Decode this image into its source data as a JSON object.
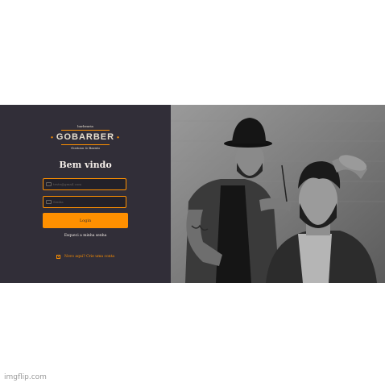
{
  "brand": {
    "top_text": "barbearia",
    "name": "GOBARBER",
    "tagline": "Gostoso & Barato"
  },
  "login": {
    "title": "Bem vindo",
    "email_placeholder": "teste@gmail.com",
    "password_placeholder": "Senha",
    "submit_label": "Login",
    "forgot_label": "Esqueci a minha senha",
    "create_label": "Novo aqui? Crie uma conta"
  },
  "colors": {
    "accent": "#ff9000",
    "panel_bg": "#312e38",
    "input_bg": "#232129",
    "text": "#f4ede8"
  },
  "watermark": "imgflip.com"
}
